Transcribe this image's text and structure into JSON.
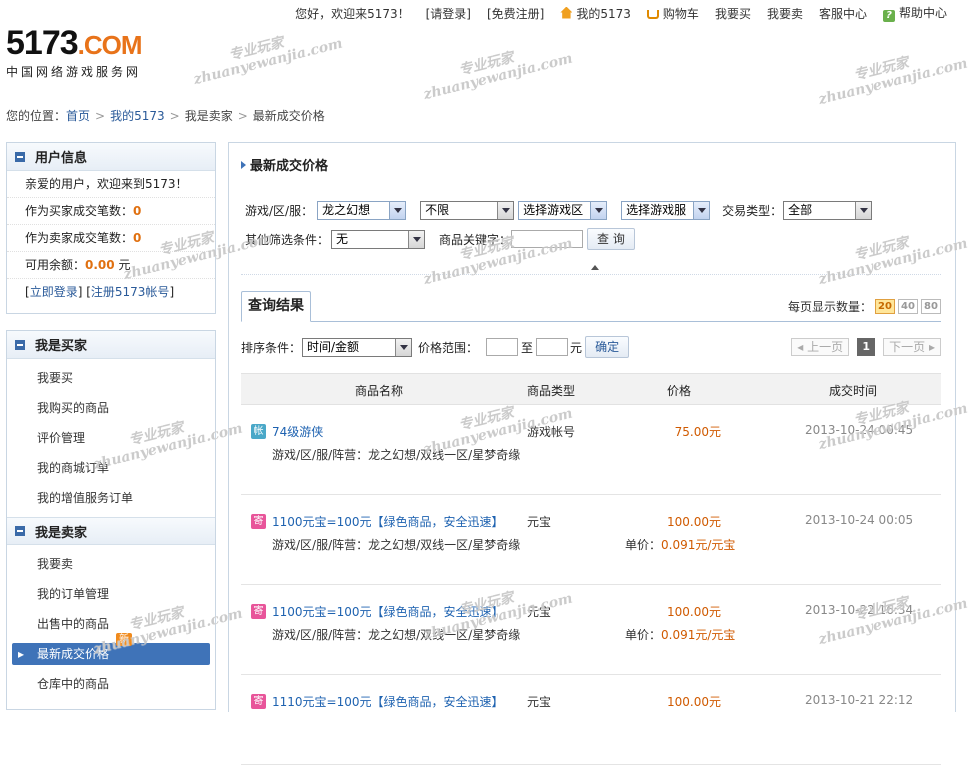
{
  "topbar": {
    "greeting": "您好，欢迎来5173！",
    "login": "[请登录]",
    "register": "[免费注册]",
    "my5173": "我的5173",
    "cart": "购物车",
    "buy": "我要买",
    "sell": "我要卖",
    "service": "客服中心",
    "help": "帮助中心"
  },
  "logo": {
    "brand": "5173",
    "com": ".COM",
    "tagline": "中国网络游戏服务网"
  },
  "breadcrumb": {
    "prefix": "您的位置：",
    "items": [
      "首页",
      "我的5173",
      "我是卖家",
      "最新成交价格"
    ]
  },
  "user_info": {
    "title": "用户信息",
    "welcome": "亲爱的用户，欢迎来到5173！",
    "buyer_deals_label": "作为买家成交笔数：",
    "buyer_deals": "0",
    "seller_deals_label": "作为卖家成交笔数：",
    "seller_deals": "0",
    "balance_label": "可用余额：",
    "balance": "0.00",
    "balance_unit": "元",
    "login_link": "立即登录",
    "register_link": "注册5173帐号"
  },
  "buyer_menu": {
    "title": "我是买家",
    "items": [
      "我要买",
      "我购买的商品",
      "评价管理",
      "我的商城订单",
      "我的增值服务订单"
    ]
  },
  "seller_menu": {
    "title": "我是卖家",
    "items": [
      "我要卖",
      "我的订单管理",
      "出售中的商品",
      "最新成交价格",
      "仓库中的商品"
    ],
    "active_index": 3,
    "new_badge": "新"
  },
  "main": {
    "title": "最新成交价格",
    "filters": {
      "game_label": "游戏/区/服：",
      "game": "龙之幻想",
      "area_mode": "不限",
      "area": "选择游戏区",
      "server": "选择游戏服",
      "trade_type_label": "交易类型：",
      "trade_type": "全部",
      "other_label": "其他筛选条件：",
      "other": "无",
      "keyword_label": "商品关键字：",
      "keyword": "",
      "search_button": "查 询"
    },
    "results_tab": "查询结果",
    "per_page_label": "每页显示数量：",
    "per_page_options": [
      "20",
      "40",
      "80"
    ],
    "per_page_selected": "20",
    "sort_label": "排序条件：",
    "sort_value": "时间/金额",
    "price_range_label": "价格范围：",
    "price_to": "至",
    "price_unit": "元",
    "confirm_button": "确定",
    "pager": {
      "prev": "上一页",
      "current": "1",
      "next": "下一页"
    },
    "columns": [
      "商品名称",
      "商品类型",
      "价格",
      "成交时间"
    ],
    "rows": [
      {
        "icon": "帐",
        "icon_kind": "account",
        "name": "74级游侠",
        "server": "游戏/区/服/阵营：龙之幻想/双线一区/星梦奇缘",
        "type": "游戏帐号",
        "price": "75.00元",
        "unit_label": "",
        "unit_price": "",
        "time": "2013-10-24 00:45"
      },
      {
        "icon": "寄",
        "icon_kind": "gold",
        "name": "1100元宝=100元【绿色商品，安全迅速】",
        "server": "游戏/区/服/阵营：龙之幻想/双线一区/星梦奇缘",
        "type": "元宝",
        "price": "100.00元",
        "unit_label": "单价：",
        "unit_price": "0.091元/元宝",
        "time": "2013-10-24 00:05"
      },
      {
        "icon": "寄",
        "icon_kind": "gold",
        "name": "1100元宝=100元【绿色商品，安全迅速】",
        "server": "游戏/区/服/阵营：龙之幻想/双线一区/星梦奇缘",
        "type": "元宝",
        "price": "100.00元",
        "unit_label": "单价：",
        "unit_price": "0.091元/元宝",
        "time": "2013-10-22 16:34"
      },
      {
        "icon": "寄",
        "icon_kind": "gold",
        "name": "1110元宝=100元【绿色商品，安全迅速】",
        "server": "",
        "type": "元宝",
        "price": "100.00元",
        "unit_label": "",
        "unit_price": "",
        "time": "2013-10-21 22:12"
      }
    ]
  },
  "watermark": {
    "line1": "专业玩家",
    "line2": "zhuanyewanjia.com"
  }
}
